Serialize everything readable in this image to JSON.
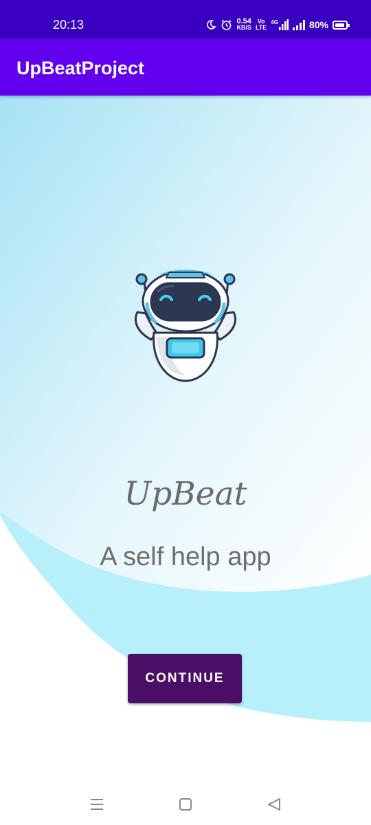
{
  "status_bar": {
    "time": "20:13",
    "speed_value": "0.54",
    "speed_unit": "KB/S",
    "volte_top": "Vo",
    "volte_bottom": "LTE",
    "network_type": "4G",
    "battery_percent": "80%",
    "icons": [
      "moon-icon",
      "alarm-icon",
      "signal-icon",
      "signal-icon",
      "battery-icon"
    ]
  },
  "app_bar": {
    "title": "UpBeatProject",
    "color": "#6200ee"
  },
  "main": {
    "logo_text": "UpBeat",
    "tagline": "A self help app",
    "continue_label": "CONTINUE",
    "button_color": "#4a0e66",
    "image": "robot-mascot"
  },
  "nav_bar": {
    "icons": [
      "recent-apps-icon",
      "home-icon",
      "back-icon"
    ]
  }
}
